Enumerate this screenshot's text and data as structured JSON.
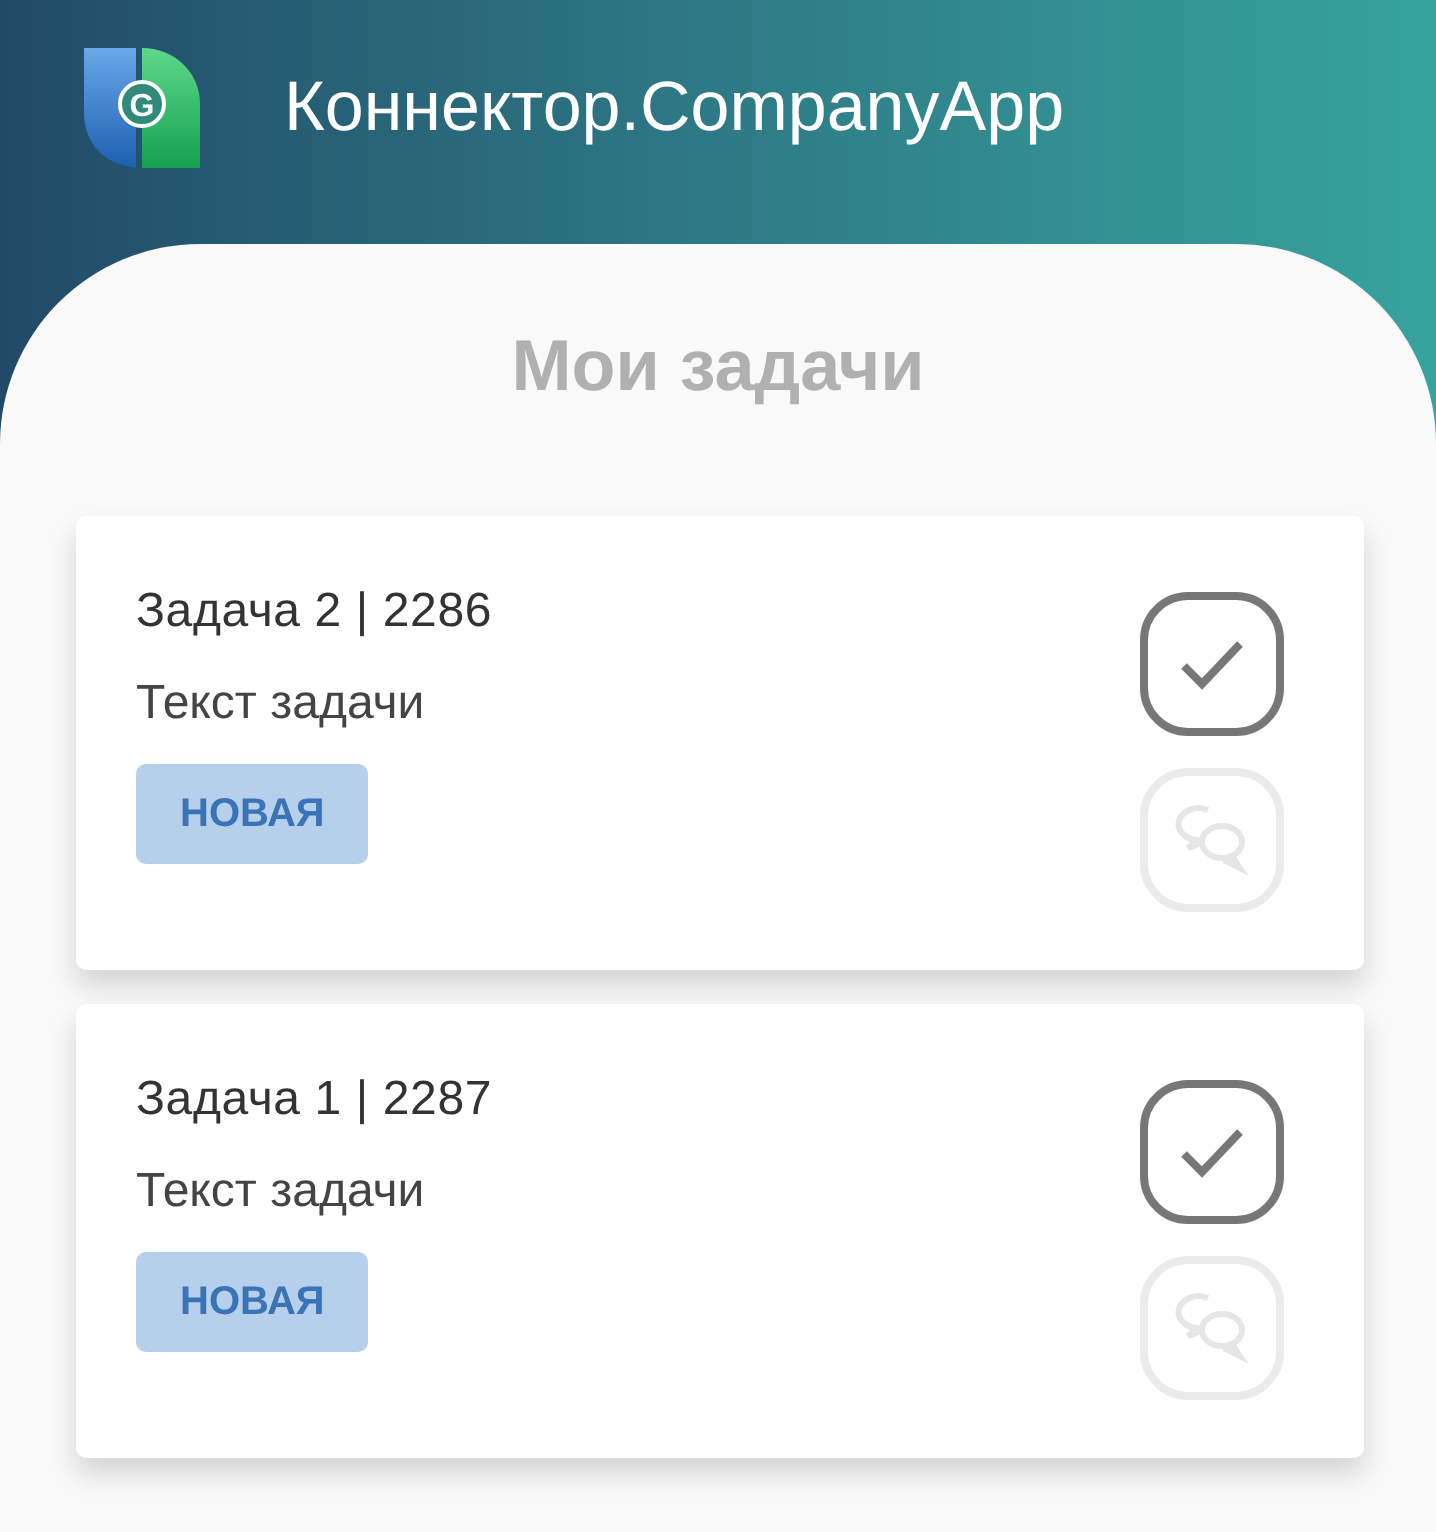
{
  "app": {
    "logo_letter": "G",
    "title": "Коннектор.CompanyApp"
  },
  "page_title": "Мои задачи",
  "tasks": [
    {
      "title": "Задача 2 | 2286",
      "text": "Текст задачи",
      "status": "НОВАЯ",
      "comment_disabled": true
    },
    {
      "title": "Задача 1 | 2287",
      "text": "Текст задачи",
      "status": "НОВАЯ",
      "comment_disabled": true
    }
  ]
}
